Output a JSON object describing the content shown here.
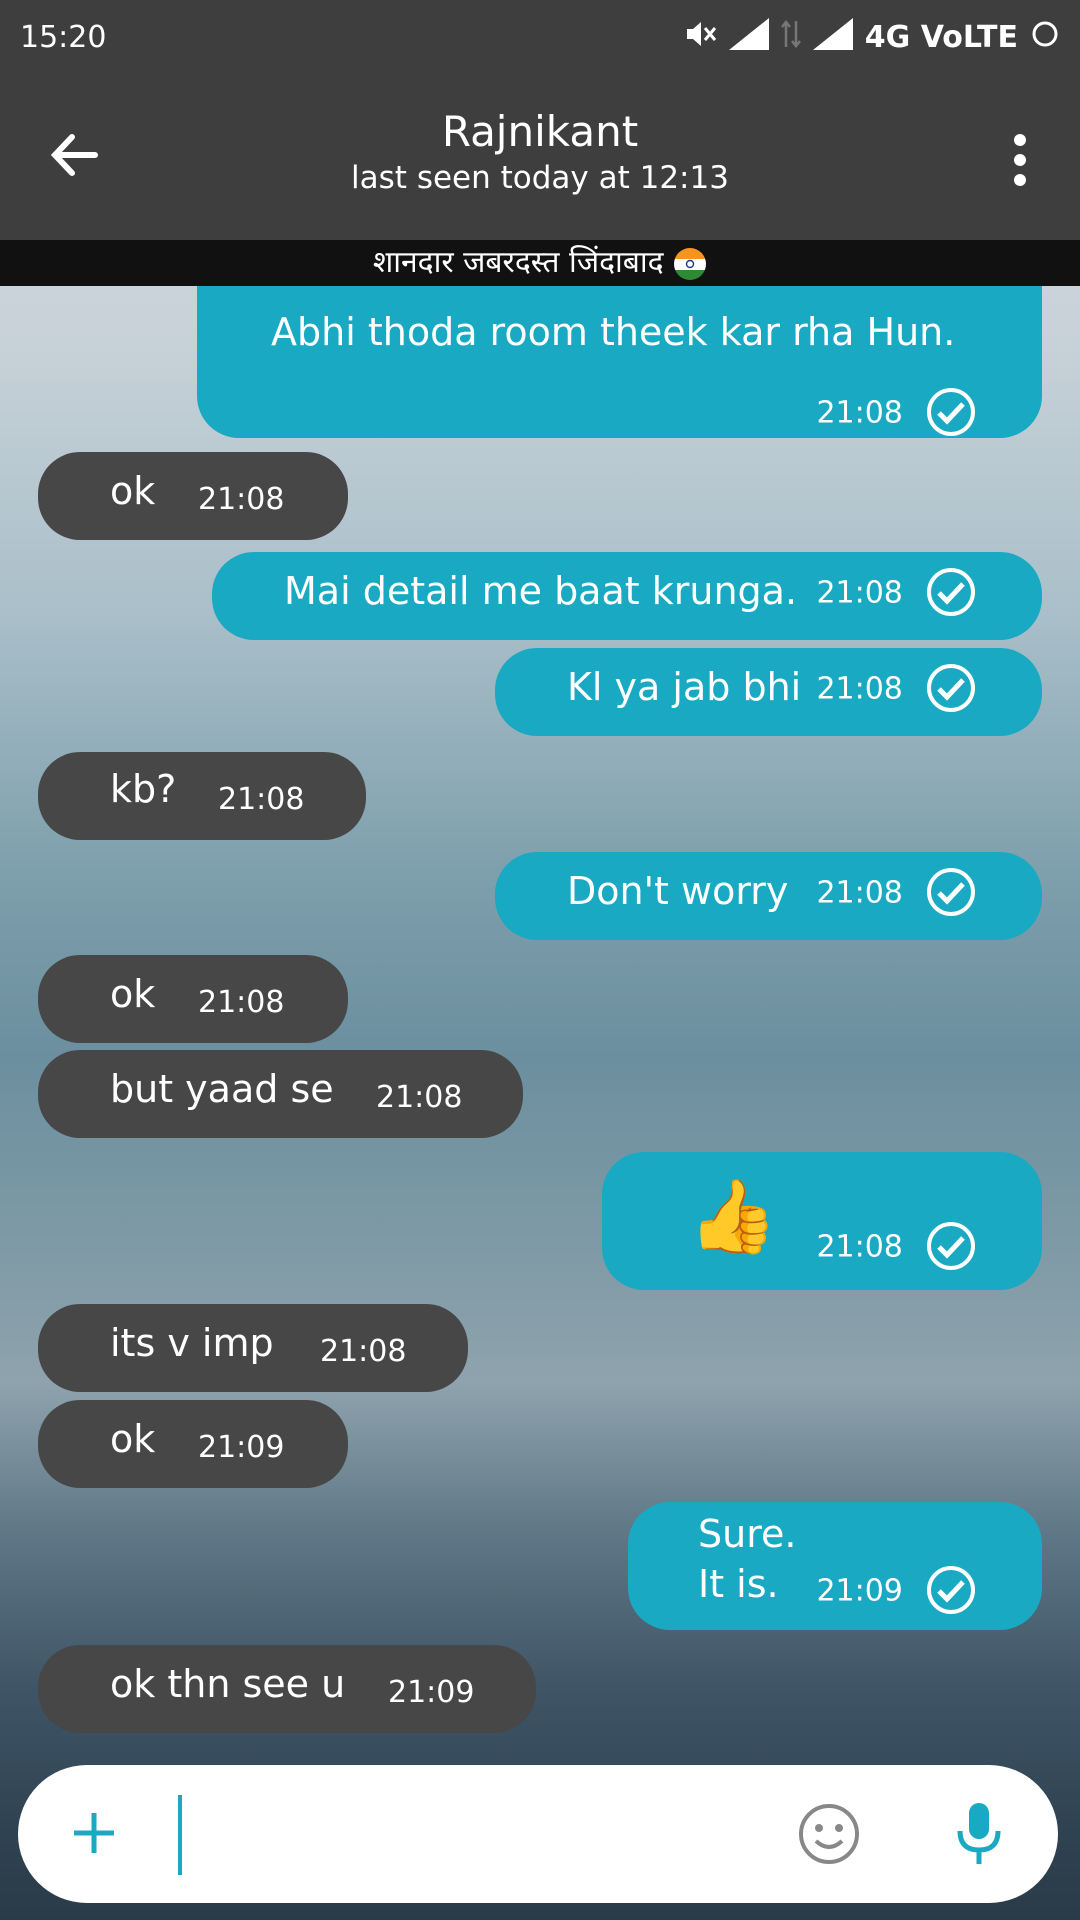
{
  "status_bar": {
    "time": "15:20",
    "network": "4G VoLTE"
  },
  "header": {
    "contact_name": "Rajnikant",
    "last_seen": "last seen today at 12:13"
  },
  "banner": {
    "text": "शानदार जबरदस्त जिंदाबाद"
  },
  "messages": [
    {
      "side": "out",
      "text": "Abhi thoda room theek kar rha Hun.",
      "time": "21:08"
    },
    {
      "side": "in",
      "text": "ok",
      "time": "21:08"
    },
    {
      "side": "out",
      "text": "Mai detail me baat krunga.",
      "time": "21:08"
    },
    {
      "side": "out",
      "text": "Kl ya jab bhi",
      "time": "21:08"
    },
    {
      "side": "in",
      "text": "kb?",
      "time": "21:08"
    },
    {
      "side": "out",
      "text": "Don't worry",
      "time": "21:08"
    },
    {
      "side": "in",
      "text": "ok",
      "time": "21:08"
    },
    {
      "side": "in",
      "text": "but yaad se",
      "time": "21:08"
    },
    {
      "side": "out",
      "text": "👍",
      "time": "21:08"
    },
    {
      "side": "in",
      "text": "its v imp",
      "time": "21:08"
    },
    {
      "side": "in",
      "text": "ok",
      "time": "21:09"
    },
    {
      "side": "out",
      "text": "Sure.",
      "text2": "It is.",
      "time": "21:09"
    },
    {
      "side": "in",
      "text": "ok thn see u",
      "time": "21:09"
    }
  ],
  "composer": {
    "placeholder": ""
  },
  "colors": {
    "outgoing": "#1aa9c2",
    "incoming": "#474747",
    "bar": "#3e3e3e"
  },
  "icons": [
    "back-arrow-icon",
    "more-vert-icon",
    "read-tick-icon",
    "add-icon",
    "emoji-icon",
    "mic-icon",
    "india-flag-icon"
  ]
}
